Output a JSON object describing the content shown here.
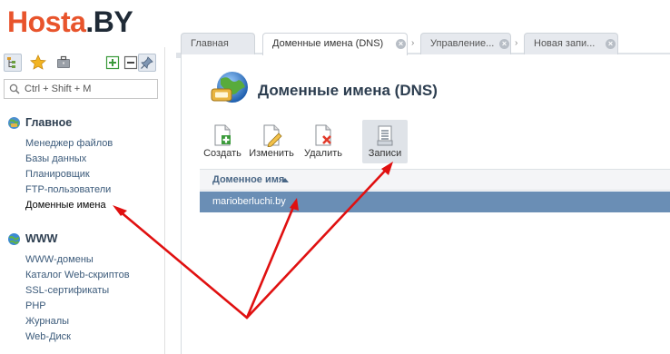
{
  "logo": {
    "part1": "Hosta",
    "part2": ".BY"
  },
  "sidebar": {
    "toolbar_icons": [
      "tree-view-icon",
      "star-icon",
      "briefcase-icon",
      "expand-plus-icon",
      "collapse-minus-icon",
      "pin-icon"
    ],
    "search": {
      "placeholder": "Ctrl + Shift + M"
    },
    "sections": [
      {
        "title": "Главное",
        "items": [
          "Менеджер файлов",
          "Базы данных",
          "Планировщик",
          "FTP-пользователи",
          "Доменные имена"
        ],
        "active_index": 4
      },
      {
        "title": "WWW",
        "items": [
          "WWW-домены",
          "Каталог Web-скриптов",
          "SSL-сертификаты",
          "PHP",
          "Журналы",
          "Web-Диск"
        ]
      }
    ]
  },
  "tabs": [
    {
      "label": "Главная"
    },
    {
      "label": "Доменные имена (DNS)",
      "active": true
    },
    {
      "label": "Управление..."
    },
    {
      "label": "Новая запи..."
    }
  ],
  "main": {
    "title": "Доменные имена (DNS)",
    "actions": [
      {
        "label": "Создать",
        "icon": "create-doc-icon"
      },
      {
        "label": "Изменить",
        "icon": "edit-doc-icon"
      },
      {
        "label": "Удалить",
        "icon": "delete-doc-icon"
      },
      {
        "label": "Записи",
        "icon": "records-icon",
        "selected": true
      }
    ],
    "table": {
      "column": "Доменное имя",
      "rows": [
        "marioberluchi.by"
      ]
    }
  },
  "colors": {
    "logo_orange": "#e8542c",
    "selected_row": "#6a8eb5",
    "annotation_arrow": "#e01010"
  }
}
